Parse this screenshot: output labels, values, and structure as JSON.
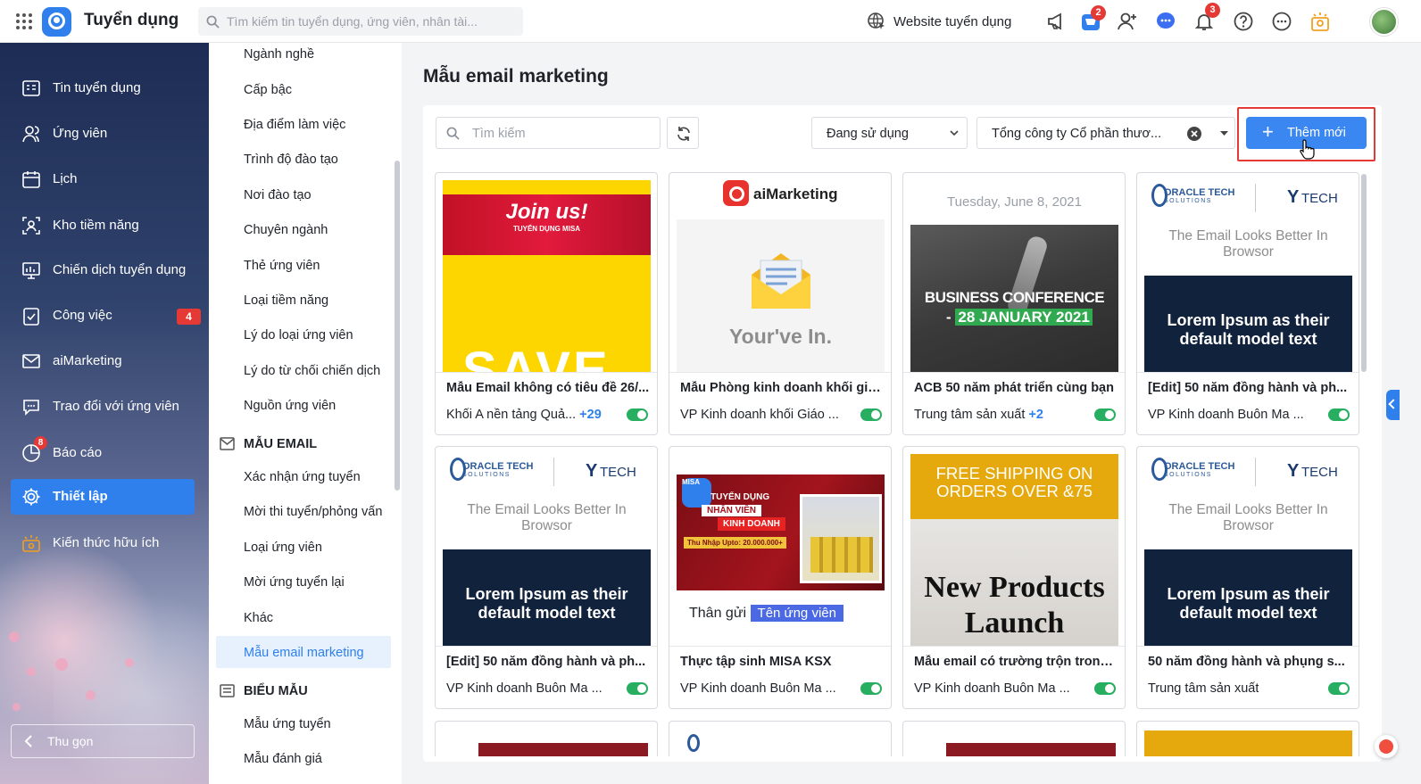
{
  "header": {
    "app_title": "Tuyển dụng",
    "search_placeholder": "Tìm kiếm tin tuyển dụng, ứng viên, nhân tài...",
    "website_link": "Website tuyển dụng",
    "cart_badge": "2",
    "notif_badge": "3"
  },
  "sidebar": {
    "items": [
      {
        "label": "Tin tuyển dụng",
        "icon": "job-post-icon"
      },
      {
        "label": "Ứng viên",
        "icon": "candidates-icon"
      },
      {
        "label": "Lịch",
        "icon": "calendar-icon"
      },
      {
        "label": "Kho tiềm năng",
        "icon": "talent-pool-icon"
      },
      {
        "label": "Chiến dịch tuyển dụng",
        "icon": "campaign-icon"
      },
      {
        "label": "Công việc",
        "icon": "task-icon",
        "badge": "4"
      },
      {
        "label": "aiMarketing",
        "icon": "mail-icon"
      },
      {
        "label": "Trao đổi với ứng viên",
        "icon": "chat-icon",
        "badge": "8"
      },
      {
        "label": "Báo cáo",
        "icon": "report-icon"
      },
      {
        "label": "Thiết lập",
        "icon": "settings-icon",
        "active": true
      },
      {
        "label": "Kiến thức hữu ích",
        "icon": "knowledge-icon"
      }
    ],
    "collapse_label": "Thu gọn"
  },
  "settings_menu": {
    "items_top": [
      "Ngành nghề",
      "Cấp bậc",
      "Địa điểm làm việc",
      "Trình độ đào tạo",
      "Nơi đào tạo",
      "Chuyên ngành",
      "Thẻ ứng viên",
      "Loại tiềm năng",
      "Lý do loại ứng viên",
      "Lý do từ chối chiến dịch",
      "Nguồn ứng viên"
    ],
    "group_email": "MẪU EMAIL",
    "items_email": [
      "Xác nhận ứng tuyển",
      "Mời thi tuyển/phỏng vấn",
      "Loại ứng viên",
      "Mời ứng tuyển lại",
      "Khác",
      "Mẫu email marketing"
    ],
    "group_form": "BIỂU MẪU",
    "items_form": [
      "Mẫu ứng tuyển",
      "Mẫu đánh giá"
    ]
  },
  "main": {
    "title": "Mẫu email marketing",
    "search_placeholder": "Tìm kiếm",
    "status_filter": "Đang sử dụng",
    "company_filter": "Tổng công ty Cổ phần thươ...",
    "add_button": "Thêm mới"
  },
  "thumbs": {
    "join": "Join us!",
    "join_sub": "TUYỂN DỤNG MISA",
    "save": "SAVE",
    "aim_brand": "aiMarketing",
    "youre": "Your've In.",
    "date": "Tuesday, June 8, 2021",
    "biz1": "BUSINESS CONFERENCE",
    "biz2_pre": "- ",
    "biz2_hl": "28 JANUARY 2021",
    "oracle1": "ORACLE TECH",
    "oracle2": "SOLUTIONS",
    "ytech": "TECH",
    "browsor": "The Email Looks Better In Browsor",
    "lorem": "Lorem Ipsum as their default model text",
    "misa_logo": "MISA",
    "misa1": "TUYỂN DỤNG",
    "misa2": "NHÂN VIÊN",
    "misa3": "KINH DOANH",
    "misa4": "Thu Nhập Upto: 20.000.000+",
    "thangui": "Thân gửi",
    "tenungvien": "Tên ứng viên",
    "ship": "FREE SHIPPING ON ORDERS OVER &75",
    "newp": "New Products Launch"
  },
  "cards": [
    {
      "title": "Mẫu Email không có tiêu đề 26/...",
      "unit": "Khối A nền tảng Quả...",
      "extra": "+29"
    },
    {
      "title": "Mẫu Phòng kinh doanh khối giá...",
      "unit": "VP Kinh doanh khối Giáo ...",
      "extra": ""
    },
    {
      "title": "ACB 50 năm phát triển cùng bạn",
      "unit": "Trung tâm sản xuất",
      "extra": "+2"
    },
    {
      "title": "[Edit] 50 năm đồng hành và ph...",
      "unit": "VP Kinh doanh Buôn Ma ...",
      "extra": ""
    },
    {
      "title": "[Edit] 50 năm đồng hành và ph...",
      "unit": "VP Kinh doanh Buôn Ma ...",
      "extra": ""
    },
    {
      "title": "Thực tập sinh MISA KSX",
      "unit": "VP Kinh doanh Buôn Ma ...",
      "extra": ""
    },
    {
      "title": "Mẫu email có trường trộn trong ...",
      "unit": "VP Kinh doanh Buôn Ma ...",
      "extra": ""
    },
    {
      "title": "50 năm đồng hành và phụng s...",
      "unit": "Trung tâm sản xuất",
      "extra": ""
    }
  ],
  "colors": {
    "primary": "#2f80ed",
    "toggle_on": "#27ae60",
    "badge": "#e53935",
    "highlight_border": "#e53935"
  }
}
